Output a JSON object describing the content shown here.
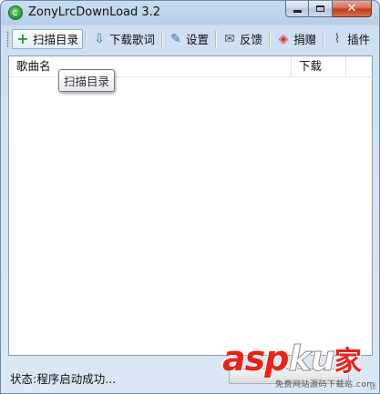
{
  "window": {
    "title": "ZonyLrcDownLoad 3.2",
    "icon": "app-logo-icon",
    "caption": {
      "minimize_glyph": "minimize-icon",
      "maximize_glyph": "maximize-icon",
      "close_glyph": "✕"
    }
  },
  "toolbar": {
    "items": [
      {
        "id": "scan",
        "label": "扫描目录",
        "icon": "plus-icon",
        "glyph": "+",
        "color": "#2e9a2e"
      },
      {
        "id": "download",
        "label": "下载歌词",
        "icon": "download-icon",
        "glyph": "⇩",
        "color": "#2a7ec8"
      },
      {
        "id": "settings",
        "label": "设置",
        "icon": "settings-doc-icon",
        "glyph": "✎",
        "color": "#3b6aa6"
      },
      {
        "id": "feedback",
        "label": "反馈",
        "icon": "mail-icon",
        "glyph": "✉",
        "color": "#555555"
      },
      {
        "id": "donate",
        "label": "捐赠",
        "icon": "tag-icon",
        "glyph": "◈",
        "color": "#d03a2a"
      },
      {
        "id": "plugins",
        "label": "插件",
        "icon": "paperclip-icon",
        "glyph": "⌇",
        "color": "#555555"
      }
    ]
  },
  "list": {
    "columns": [
      "歌曲名",
      "下载"
    ]
  },
  "tooltip": {
    "text": "扫描目录"
  },
  "status": {
    "text": "状态:程序启动成功..."
  },
  "watermark": {
    "brand_a": "asp",
    "brand_b": "ku",
    "brand_c": "家",
    "subtitle": "免费网站源码下载站",
    "url": ".com"
  }
}
